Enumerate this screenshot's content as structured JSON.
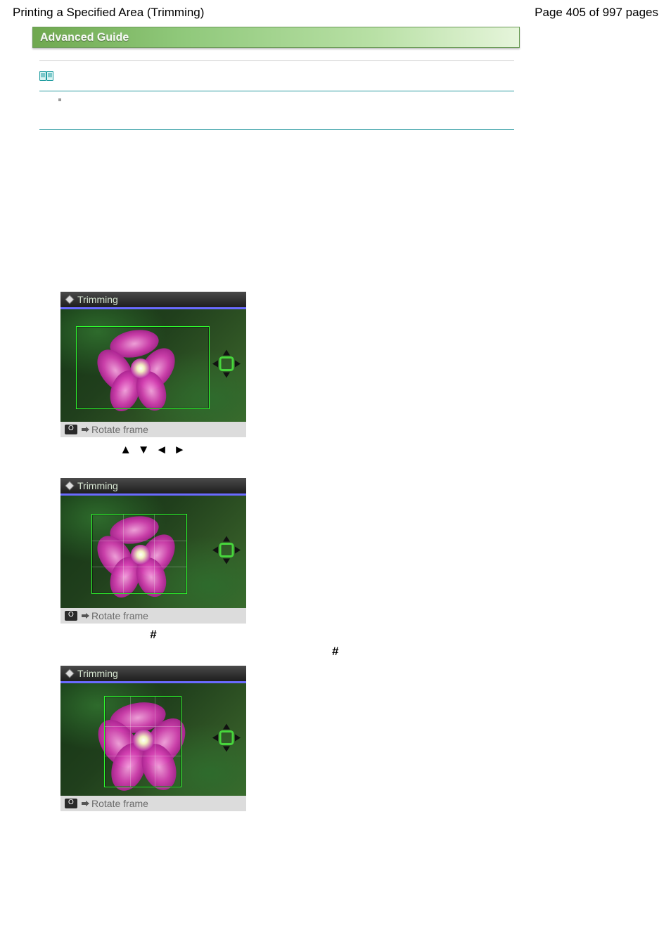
{
  "header": {
    "title": "Printing a Specified Area (Trimming)",
    "page_info": "Page 405 of 997 pages"
  },
  "banner": {
    "text": "Advanced Guide"
  },
  "icons": {
    "note": "note-book-icon"
  },
  "panels": {
    "p1": {
      "title": "Trimming",
      "footer_text": "Rotate frame"
    },
    "p2": {
      "title": "Trimming",
      "footer_text": "Rotate frame"
    },
    "p3": {
      "title": "Trimming",
      "footer_text": "Rotate frame"
    }
  },
  "captions": {
    "arrows_caption": "▲ ▼ ◄ ►",
    "hash1": "#",
    "hash2": "#"
  }
}
